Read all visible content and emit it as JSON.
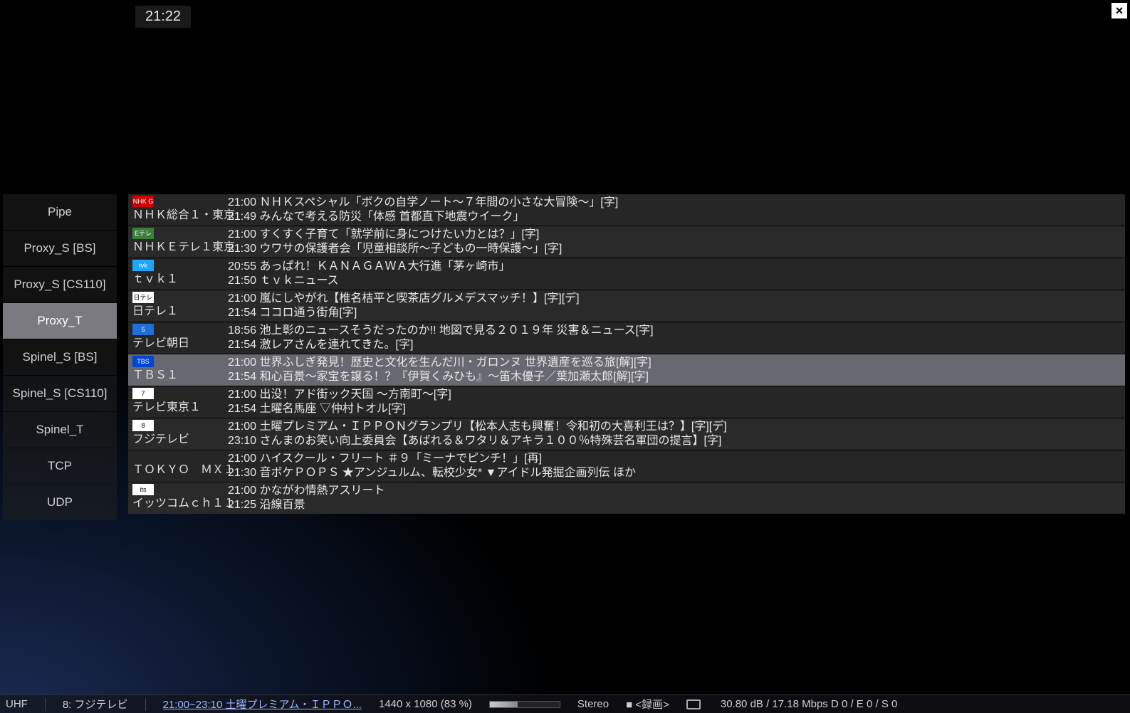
{
  "clock": "21:22",
  "sidebar": {
    "items": [
      "Pipe",
      "Proxy_S [BS]",
      "Proxy_S [CS110]",
      "Proxy_T",
      "Spinel_S [BS]",
      "Spinel_S [CS110]",
      "Spinel_T",
      "TCP",
      "UDP"
    ],
    "selected_index": 3
  },
  "channels": [
    {
      "logo_bg": "#c00",
      "logo_text": "NHK G",
      "name": "ＮＨＫ総合１・東京",
      "line1": "21:00 ＮＨＫスペシャル「ボクの自学ノート～７年間の小さな大冒険～」[字]",
      "line2": "21:49 みんなで考える防災「体感 首都直下地震ウイーク」",
      "highlight": false
    },
    {
      "logo_bg": "#3a7e3a",
      "logo_text": "Eテレ",
      "name": "ＮＨＫＥテレ１東京",
      "line1": "21:00 すくすく子育て「就学前に身につけたい力とは？」[字]",
      "line2": "21:30 ウワサの保護者会「児童相談所～子どもの一時保護～」[字]",
      "highlight": false
    },
    {
      "logo_bg": "#1fa7ff",
      "logo_text": "tvk",
      "name": "ｔｖｋ１",
      "line1": "20:55 あっぱれ！ＫＡＮＡＧＡＷＡ大行進「茅ヶ崎市」",
      "line2": "21:50 ｔｖｋニュース",
      "highlight": false
    },
    {
      "logo_bg": "#fff",
      "logo_text": "日テレ",
      "name": "日テレ１",
      "line1": "21:00 嵐にしやがれ【椎名桔平と喫茶店グルメデスマッチ！】[字][デ]",
      "line2": "21:54 ココロ通う街角[字]",
      "highlight": false
    },
    {
      "logo_bg": "#1e6fd8",
      "logo_text": "5",
      "name": "テレビ朝日",
      "line1": "18:56 池上彰のニュースそうだったのか!!  地図で見る２０１９年 災害＆ニュース[字]",
      "line2": "21:54 激レアさんを連れてきた。[字]",
      "highlight": false
    },
    {
      "logo_bg": "#0046d4",
      "logo_text": "TBS",
      "name": "ＴＢＳ１",
      "line1": "21:00 世界ふしぎ発見！歴史と文化を生んだ川・ガロンヌ  世界遺産を巡る旅[解][字]",
      "line2": "21:54 和心百景～家宝を譲る！？『伊賀くみひも』～笛木優子／葉加瀬太郎[解][字]",
      "highlight": true
    },
    {
      "logo_bg": "#fff",
      "logo_text": "7",
      "name": "テレビ東京１",
      "line1": "21:00 出没！アド街ック天国  ～方南町～[字]",
      "line2": "21:54 土曜名馬座  ▽仲村トオル[字]",
      "highlight": false
    },
    {
      "logo_bg": "#fff",
      "logo_text": "8",
      "name": "フジテレビ",
      "line1": "21:00 土曜プレミアム・ＩＰＰＯＮグランプリ【松本人志も興奮！令和初の大喜利王は？】[字][デ]",
      "line2": "23:10 さんまのお笑い向上委員会【あばれる＆ワタリ＆アキラ１００％特殊芸名軍団の提言】[字]",
      "highlight": false
    },
    {
      "logo_bg": "",
      "logo_text": "",
      "name": "ＴＯＫＹＯ　ＭＸ１",
      "line1": "21:00 ハイスクール・フリート  ＃９「ミーナでピンチ！」[再]",
      "line2": "21:30 音ボケＰＯＰＳ  ★アンジュルム、転校少女*  ▼アイドル発掘企画列伝 ほか",
      "highlight": false,
      "no_logo": true
    },
    {
      "logo_bg": "#fff",
      "logo_text": "its",
      "name": "イッツコムｃｈ１１",
      "line1": "21:00 かながわ情熱アスリート",
      "line2": "21:25 沿線百景",
      "highlight": false
    }
  ],
  "status": {
    "band": "UHF",
    "channel_label": "8: フジテレビ",
    "program_title": "21:00~23:10 土曜プレミアム・ＩＰＰＯ...",
    "resolution": "1440 x 1080 (83 %)",
    "audio_mode": "Stereo",
    "rec_label": "■ <録画>",
    "signal": "30.80 dB / 17.18 Mbps  D 0 / E 0 / S 0"
  }
}
